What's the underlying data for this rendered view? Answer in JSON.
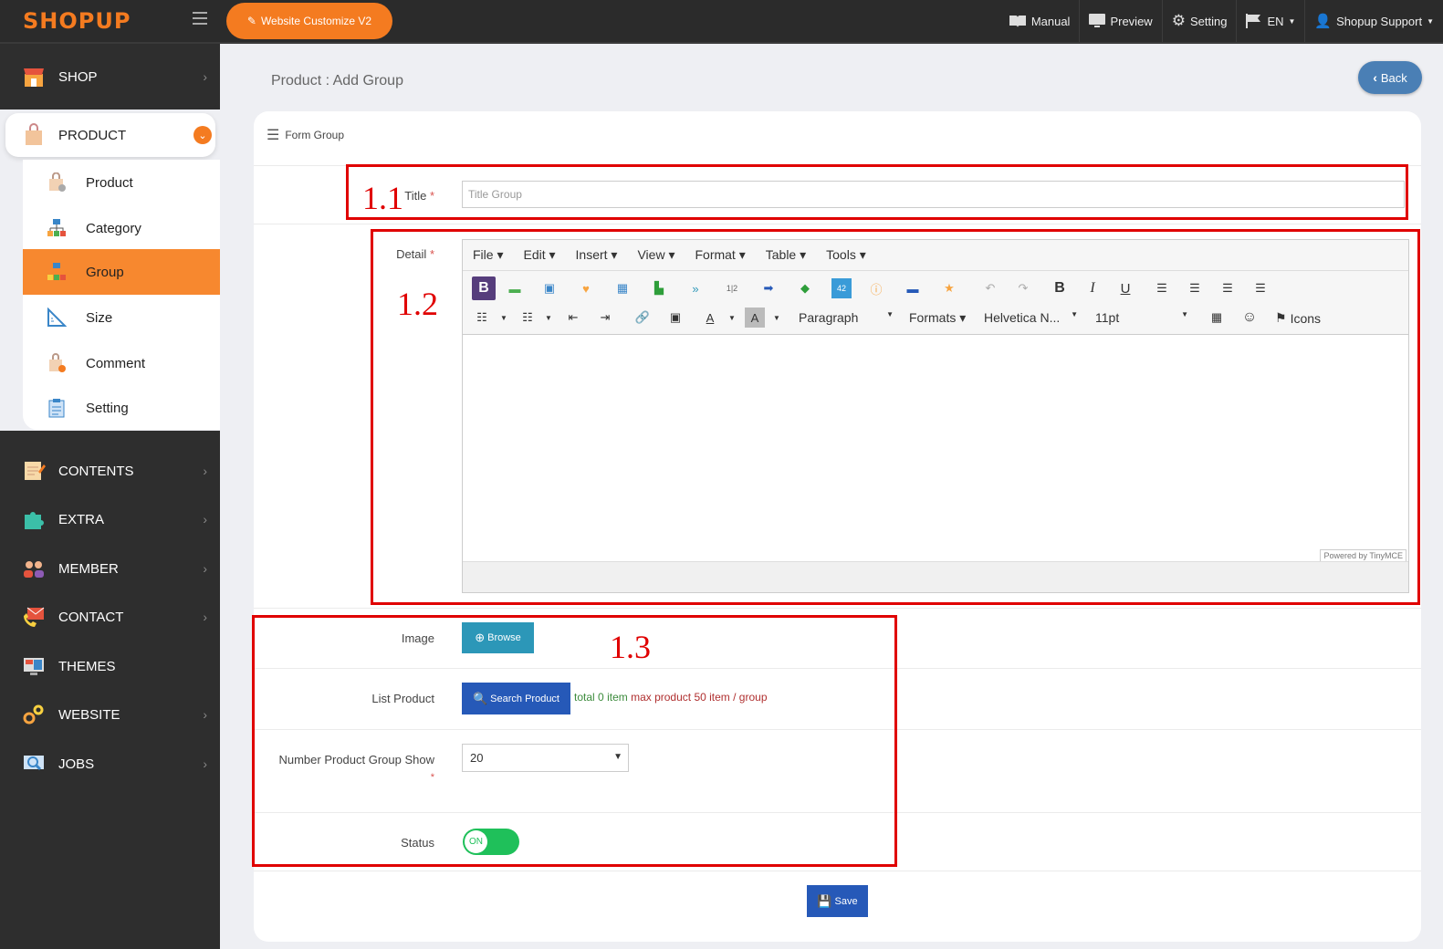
{
  "header": {
    "logo": "SHOPUP",
    "customize_label": "Website Customize V2",
    "nav": {
      "manual": "Manual",
      "preview": "Preview",
      "setting": "Setting",
      "language": "EN",
      "user": "Shopup Support"
    }
  },
  "sidebar": {
    "shop": "SHOP",
    "product": "PRODUCT",
    "sub": [
      "Product",
      "Category",
      "Group",
      "Size",
      "Comment",
      "Setting"
    ],
    "items": [
      "CONTENTS",
      "EXTRA",
      "MEMBER",
      "CONTACT",
      "THEMES",
      "WEBSITE",
      "JOBS"
    ]
  },
  "page": {
    "title": "Product : Add Group",
    "back": "Back"
  },
  "form": {
    "head": "Form Group",
    "title_label": "Title",
    "title_placeholder": "Title Group",
    "detail_label": "Detail",
    "menu": [
      "File",
      "Edit",
      "Insert",
      "View",
      "Format",
      "Table",
      "Tools"
    ],
    "toolbar": {
      "paragraph": "Paragraph",
      "formats": "Formats",
      "font": "Helvetica N...",
      "size": "11pt",
      "icons": "Icons"
    },
    "powered": "Powered by TinyMCE",
    "image_label": "Image",
    "browse": "Browse",
    "list_label": "List Product",
    "search": "Search Product",
    "info_total": "total",
    "info_count": "0",
    "info_item": "item",
    "info_max": "max product 50 item / group",
    "number_label": "Number Product Group Show",
    "number_value": "20",
    "status_label": "Status",
    "status_value": "ON",
    "save": "Save"
  },
  "annotations": {
    "a1": "1.1",
    "a2": "1.2",
    "a3": "1.3"
  },
  "colors": {
    "accent": "#f47b20",
    "primary": "#2659b8",
    "annotation": "#e00000",
    "toggle": "#1fc05a"
  }
}
